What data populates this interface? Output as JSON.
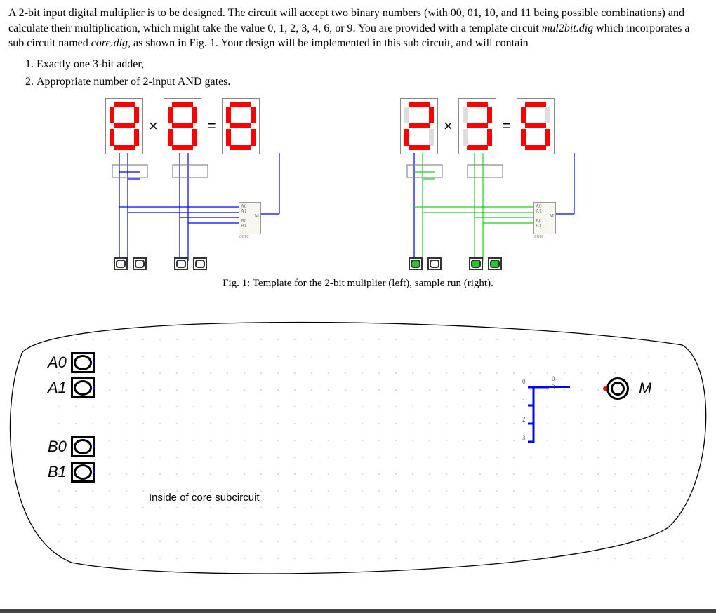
{
  "intro": {
    "p1a": "A 2-bit input digital multiplier is to be designed. The circuit will accept two binary numbers (with 00, 01, 10, and 11 being possible combinations) and calculate their multiplication, which might take the value 0, 1, 2, 3, 4, 6, or 9. You are provided with a template circuit ",
    "tpl1": "mul2bit.dig",
    "p1b": " which incorporates a sub circuit named ",
    "tpl2": "core.dig,",
    "p1c": " as shown in Fig. 1. Your design will be implemented in this sub circuit, and will contain"
  },
  "reqs": [
    "Exactly one 3-bit adder,",
    "Appropriate number of 2-input AND gates."
  ],
  "fig": {
    "caption": "Fig. 1: Template for the 2-bit muliplier (left), sample run (right).",
    "left": {
      "digits": [
        "8",
        "8",
        "8"
      ],
      "op_mult": "×",
      "op_eq": "=",
      "core_pins": [
        "A0",
        "A1",
        "B0",
        "B1"
      ],
      "core_out": "M",
      "core_name": "core"
    },
    "right": {
      "digits": [
        "2",
        "3",
        "6"
      ],
      "op_mult": "×",
      "op_eq": "=",
      "core_pins": [
        "A0",
        "A1",
        "B0",
        "B1"
      ],
      "core_out": "M",
      "core_name": "core"
    }
  },
  "sub": {
    "ports_in": [
      "A0",
      "A1",
      "B0",
      "B1"
    ],
    "port_out": "M",
    "note": "Inside of core subcircuit",
    "merge_labels": [
      "0",
      "0-3",
      "1",
      "2",
      "3"
    ]
  }
}
